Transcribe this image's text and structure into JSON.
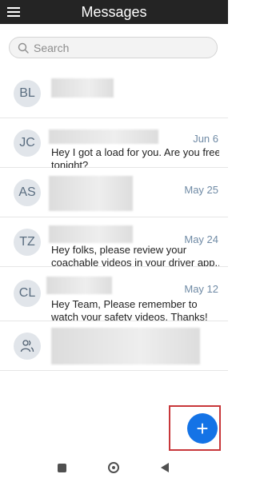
{
  "header": {
    "title": "Messages",
    "menu_icon": "hamburger-icon"
  },
  "search": {
    "placeholder": "Search",
    "icon": "search-icon"
  },
  "conversations": [
    {
      "initials": "BL",
      "date": "",
      "preview": []
    },
    {
      "initials": "JC",
      "date": "Jun 6",
      "preview": [
        "Hey I got a load for you. Are you free",
        "tonight?"
      ]
    },
    {
      "initials": "AS",
      "date": "May 25",
      "preview": []
    },
    {
      "initials": "TZ",
      "date": "May 24",
      "preview": [
        "Hey folks, please review your",
        "coachable videos in your driver app...."
      ]
    },
    {
      "initials": "CL",
      "date": "May 12",
      "preview": [
        "Hey Team, Please remember to",
        "watch your safety videos. Thanks!"
      ]
    },
    {
      "initials": "",
      "icon": "group-icon",
      "date": "",
      "preview": []
    }
  ],
  "fab": {
    "label": "+",
    "icon": "plus-icon"
  },
  "system_nav": [
    "recents-square-icon",
    "home-circle-icon",
    "back-triangle-icon"
  ]
}
